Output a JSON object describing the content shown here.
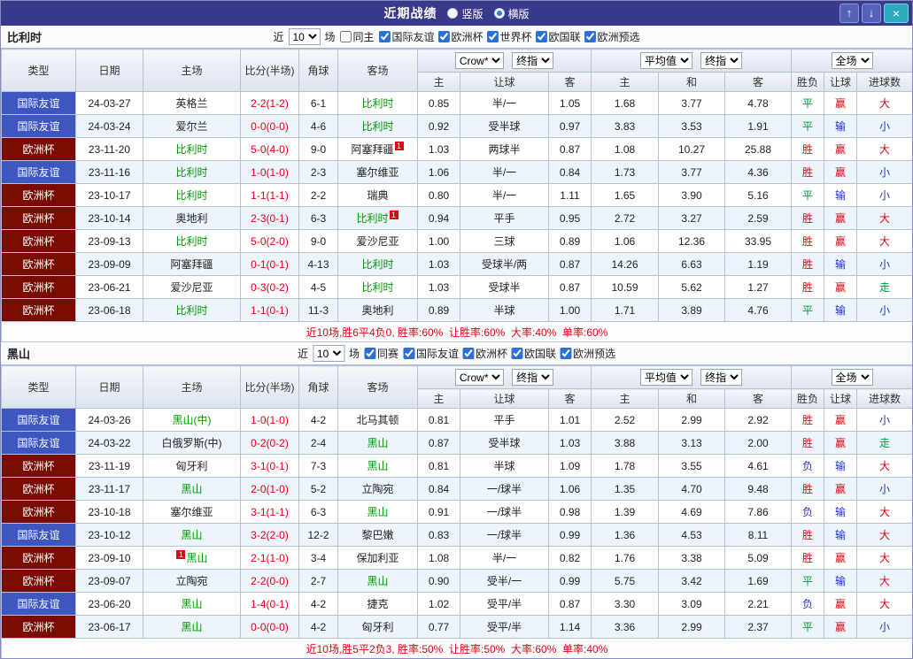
{
  "titlebar": {
    "title": "近期战绩",
    "radios": [
      {
        "label": "竖版"
      },
      {
        "label": "横版"
      }
    ],
    "selected_index": 1,
    "buttons": {
      "up": "↑",
      "down": "↓",
      "close": "×"
    }
  },
  "labels": {
    "near": "近",
    "games": "场"
  },
  "table": {
    "col_type": "类型",
    "col_date": "日期",
    "col_home": "主场",
    "col_score": "比分(半场)",
    "col_corner": "角球",
    "col_away": "客场",
    "bookmaker": "Crow*",
    "final_label": "终指",
    "average_label": "平均值",
    "fulltime_label": "全场",
    "sub_home": "主",
    "sub_handicap": "让球",
    "sub_away": "客",
    "sub_draw": "和",
    "sub_wdl": "胜负",
    "sub_goals": "进球数"
  },
  "result_colors": {
    "胜": "#e60012",
    "平": "#009933",
    "负": "#2233cc",
    "赢": "#e60012",
    "输": "#2233cc",
    "走": "#009933",
    "大": "#e60012",
    "小": "#2233cc"
  },
  "sections": [
    {
      "team": "比利时",
      "filter": {
        "count": "10",
        "same_label": "同主",
        "same_checked": false,
        "comps": [
          "国际友谊",
          "欧洲杯",
          "世界杯",
          "欧国联",
          "欧洲预选"
        ]
      },
      "rows": [
        {
          "type": "国际友谊",
          "type_class": "friendly",
          "date": "24-03-27",
          "home": "英格兰",
          "score": "2-2(1-2)",
          "corner": "6-1",
          "away": "比利时",
          "away_green": true,
          "o1": "0.85",
          "hc": "半/一",
          "o2": "1.05",
          "m1": "1.68",
          "m2": "3.77",
          "m3": "4.78",
          "r1": "平",
          "r2": "赢",
          "r3": "大"
        },
        {
          "type": "国际友谊",
          "type_class": "friendly",
          "date": "24-03-24",
          "home": "爱尔兰",
          "score": "0-0(0-0)",
          "corner": "4-6",
          "away": "比利时",
          "away_green": true,
          "o1": "0.92",
          "hc": "受半球",
          "o2": "0.97",
          "m1": "3.83",
          "m2": "3.53",
          "m3": "1.91",
          "r1": "平",
          "r2": "输",
          "r3": "小"
        },
        {
          "type": "欧洲杯",
          "type_class": "eurocup",
          "date": "23-11-20",
          "home": "比利时",
          "home_green": true,
          "score": "5-0(4-0)",
          "corner": "9-0",
          "away": "阿塞拜疆",
          "away_badge": "1",
          "o1": "1.03",
          "hc": "两球半",
          "o2": "0.87",
          "m1": "1.08",
          "m2": "10.27",
          "m3": "25.88",
          "r1": "胜",
          "r2": "赢",
          "r3": "大"
        },
        {
          "type": "国际友谊",
          "type_class": "friendly",
          "date": "23-11-16",
          "home": "比利时",
          "home_green": true,
          "score": "1-0(1-0)",
          "corner": "2-3",
          "away": "塞尔维亚",
          "o1": "1.06",
          "hc": "半/一",
          "o2": "0.84",
          "m1": "1.73",
          "m2": "3.77",
          "m3": "4.36",
          "r1": "胜",
          "r2": "赢",
          "r3": "小"
        },
        {
          "type": "欧洲杯",
          "type_class": "eurocup",
          "date": "23-10-17",
          "home": "比利时",
          "home_green": true,
          "score": "1-1(1-1)",
          "corner": "2-2",
          "away": "瑞典",
          "o1": "0.80",
          "hc": "半/一",
          "o2": "1.11",
          "m1": "1.65",
          "m2": "3.90",
          "m3": "5.16",
          "r1": "平",
          "r2": "输",
          "r3": "小"
        },
        {
          "type": "欧洲杯",
          "type_class": "eurocup",
          "date": "23-10-14",
          "home": "奥地利",
          "score": "2-3(0-1)",
          "corner": "6-3",
          "away": "比利时",
          "away_green": true,
          "away_badge": "1",
          "o1": "0.94",
          "hc": "平手",
          "o2": "0.95",
          "m1": "2.72",
          "m2": "3.27",
          "m3": "2.59",
          "r1": "胜",
          "r2": "赢",
          "r3": "大"
        },
        {
          "type": "欧洲杯",
          "type_class": "eurocup",
          "date": "23-09-13",
          "home": "比利时",
          "home_green": true,
          "score": "5-0(2-0)",
          "corner": "9-0",
          "away": "爱沙尼亚",
          "o1": "1.00",
          "hc": "三球",
          "o2": "0.89",
          "m1": "1.06",
          "m2": "12.36",
          "m3": "33.95",
          "r1": "胜",
          "r2": "赢",
          "r3": "大"
        },
        {
          "type": "欧洲杯",
          "type_class": "eurocup",
          "date": "23-09-09",
          "home": "阿塞拜疆",
          "score": "0-1(0-1)",
          "corner": "4-13",
          "away": "比利时",
          "away_green": true,
          "o1": "1.03",
          "hc": "受球半/两",
          "o2": "0.87",
          "m1": "14.26",
          "m2": "6.63",
          "m3": "1.19",
          "r1": "胜",
          "r2": "输",
          "r3": "小"
        },
        {
          "type": "欧洲杯",
          "type_class": "eurocup",
          "date": "23-06-21",
          "home": "爱沙尼亚",
          "score": "0-3(0-2)",
          "corner": "4-5",
          "away": "比利时",
          "away_green": true,
          "o1": "1.03",
          "hc": "受球半",
          "o2": "0.87",
          "m1": "10.59",
          "m2": "5.62",
          "m3": "1.27",
          "r1": "胜",
          "r2": "赢",
          "r3": "走"
        },
        {
          "type": "欧洲杯",
          "type_class": "eurocup",
          "date": "23-06-18",
          "home": "比利时",
          "home_green": true,
          "score": "1-1(0-1)",
          "corner": "11-3",
          "away": "奥地利",
          "o1": "0.89",
          "hc": "半球",
          "o2": "1.00",
          "m1": "1.71",
          "m2": "3.89",
          "m3": "4.76",
          "r1": "平",
          "r2": "输",
          "r3": "小"
        }
      ],
      "summary": "近10场,胜6平4负0, 胜率:60%  让胜率:60%  大率:40%  单率:60%"
    },
    {
      "team": "黑山",
      "filter": {
        "count": "10",
        "same_label": "同赛",
        "same_checked": true,
        "comps": [
          "国际友谊",
          "欧洲杯",
          "欧国联",
          "欧洲预选"
        ]
      },
      "rows": [
        {
          "type": "国际友谊",
          "type_class": "friendly",
          "date": "24-03-26",
          "home": "黑山(中)",
          "home_green": true,
          "score": "1-0(1-0)",
          "corner": "4-2",
          "away": "北马其顿",
          "o1": "0.81",
          "hc": "平手",
          "o2": "1.01",
          "m1": "2.52",
          "m2": "2.99",
          "m3": "2.92",
          "r1": "胜",
          "r2": "赢",
          "r3": "小"
        },
        {
          "type": "国际友谊",
          "type_class": "friendly",
          "date": "24-03-22",
          "home": "白俄罗斯(中)",
          "score": "0-2(0-2)",
          "corner": "2-4",
          "away": "黑山",
          "away_green": true,
          "o1": "0.87",
          "hc": "受半球",
          "o2": "1.03",
          "m1": "3.88",
          "m2": "3.13",
          "m3": "2.00",
          "r1": "胜",
          "r2": "赢",
          "r3": "走"
        },
        {
          "type": "欧洲杯",
          "type_class": "eurocup",
          "date": "23-11-19",
          "home": "匈牙利",
          "score": "3-1(0-1)",
          "corner": "7-3",
          "away": "黑山",
          "away_green": true,
          "o1": "0.81",
          "hc": "半球",
          "o2": "1.09",
          "m1": "1.78",
          "m2": "3.55",
          "m3": "4.61",
          "r1": "负",
          "r2": "输",
          "r3": "大"
        },
        {
          "type": "欧洲杯",
          "type_class": "eurocup",
          "date": "23-11-17",
          "home": "黑山",
          "home_green": true,
          "score": "2-0(1-0)",
          "corner": "5-2",
          "away": "立陶宛",
          "o1": "0.84",
          "hc": "一/球半",
          "o2": "1.06",
          "m1": "1.35",
          "m2": "4.70",
          "m3": "9.48",
          "r1": "胜",
          "r2": "赢",
          "r3": "小"
        },
        {
          "type": "欧洲杯",
          "type_class": "eurocup",
          "date": "23-10-18",
          "home": "塞尔维亚",
          "score": "3-1(1-1)",
          "corner": "6-3",
          "away": "黑山",
          "away_green": true,
          "o1": "0.91",
          "hc": "一/球半",
          "o2": "0.98",
          "m1": "1.39",
          "m2": "4.69",
          "m3": "7.86",
          "r1": "负",
          "r2": "输",
          "r3": "大"
        },
        {
          "type": "国际友谊",
          "type_class": "friendly",
          "date": "23-10-12",
          "home": "黑山",
          "home_green": true,
          "score": "3-2(2-0)",
          "corner": "12-2",
          "away": "黎巴嫩",
          "o1": "0.83",
          "hc": "一/球半",
          "o2": "0.99",
          "m1": "1.36",
          "m2": "4.53",
          "m3": "8.11",
          "r1": "胜",
          "r2": "输",
          "r3": "大"
        },
        {
          "type": "欧洲杯",
          "type_class": "eurocup",
          "date": "23-09-10",
          "home": "黑山",
          "home_green": true,
          "home_badge": "1",
          "home_badge_pos": "pre",
          "score": "2-1(1-0)",
          "corner": "3-4",
          "away": "保加利亚",
          "o1": "1.08",
          "hc": "半/一",
          "o2": "0.82",
          "m1": "1.76",
          "m2": "3.38",
          "m3": "5.09",
          "r1": "胜",
          "r2": "赢",
          "r3": "大"
        },
        {
          "type": "欧洲杯",
          "type_class": "eurocup",
          "date": "23-09-07",
          "home": "立陶宛",
          "score": "2-2(0-0)",
          "corner": "2-7",
          "away": "黑山",
          "away_green": true,
          "o1": "0.90",
          "hc": "受半/一",
          "o2": "0.99",
          "m1": "5.75",
          "m2": "3.42",
          "m3": "1.69",
          "r1": "平",
          "r2": "输",
          "r3": "大"
        },
        {
          "type": "国际友谊",
          "type_class": "friendly",
          "date": "23-06-20",
          "home": "黑山",
          "home_green": true,
          "score": "1-4(0-1)",
          "corner": "4-2",
          "away": "捷克",
          "o1": "1.02",
          "hc": "受平/半",
          "o2": "0.87",
          "m1": "3.30",
          "m2": "3.09",
          "m3": "2.21",
          "r1": "负",
          "r2": "赢",
          "r3": "大"
        },
        {
          "type": "欧洲杯",
          "type_class": "eurocup",
          "date": "23-06-17",
          "home": "黑山",
          "home_green": true,
          "score": "0-0(0-0)",
          "corner": "4-2",
          "away": "匈牙利",
          "o1": "0.77",
          "hc": "受平/半",
          "o2": "1.14",
          "m1": "3.36",
          "m2": "2.99",
          "m3": "2.37",
          "r1": "平",
          "r2": "赢",
          "r3": "小"
        }
      ],
      "summary": "近10场,胜5平2负3, 胜率:50%  让胜率:50%  大率:60%  单率:40%"
    }
  ]
}
